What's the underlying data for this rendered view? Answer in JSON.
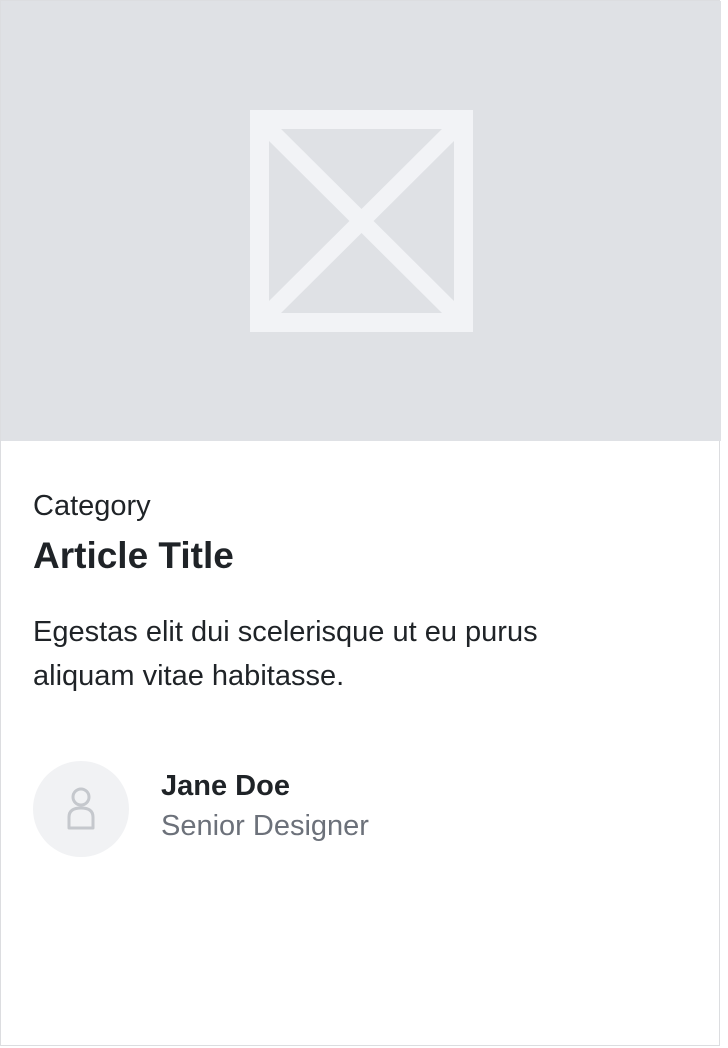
{
  "article": {
    "image_icon": "image-placeholder-icon",
    "category": "Category",
    "title": "Article Title",
    "excerpt": "Egestas elit dui scelerisque ut eu purus aliquam vitae habitasse."
  },
  "author": {
    "avatar_icon": "user-icon",
    "name": "Jane Doe",
    "role": "Senior Designer"
  },
  "colors": {
    "image_background": "#dfe1e5",
    "placeholder_stroke": "#f2f3f6",
    "text_primary": "#1f2327",
    "text_secondary": "#6c717a",
    "avatar_background": "#f1f2f4"
  }
}
